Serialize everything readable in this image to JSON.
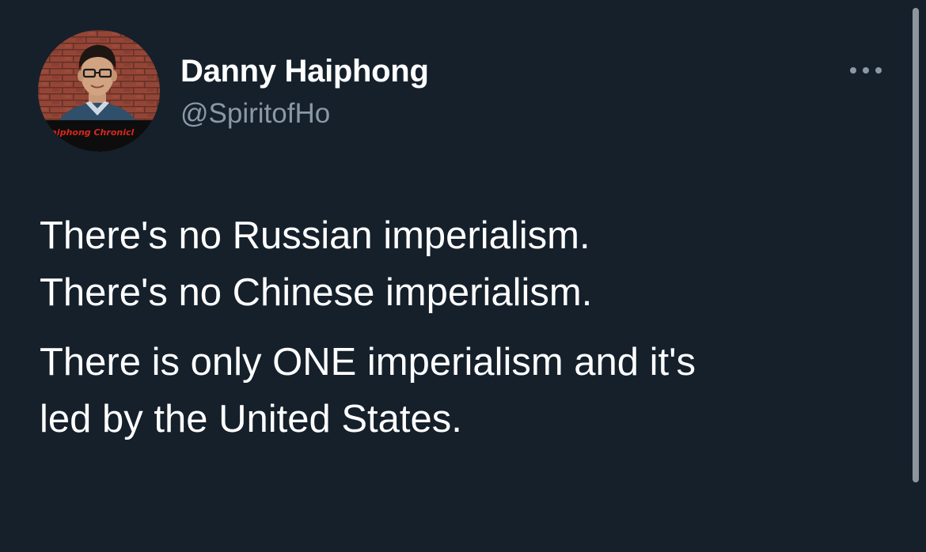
{
  "tweet": {
    "author": {
      "name": "Danny Haiphong",
      "handle": "@SpiritofHo",
      "avatar_banner_text": "e Haiphong Chronicl"
    },
    "more_icon": "more-horizontal-icon",
    "body": {
      "paragraph_1": {
        "line_1": "There's no Russian imperialism.",
        "line_2": "There's no Chinese imperialism."
      },
      "paragraph_2": {
        "line_1": "There is only ONE imperialism and it's",
        "line_2": "led by the United States."
      }
    }
  },
  "colors": {
    "background": "#15202b",
    "name_text": "#ffffff",
    "handle_text": "#8b98a5",
    "body_text": "#ffffff",
    "scrollbar_thumb": "#8e959c"
  }
}
